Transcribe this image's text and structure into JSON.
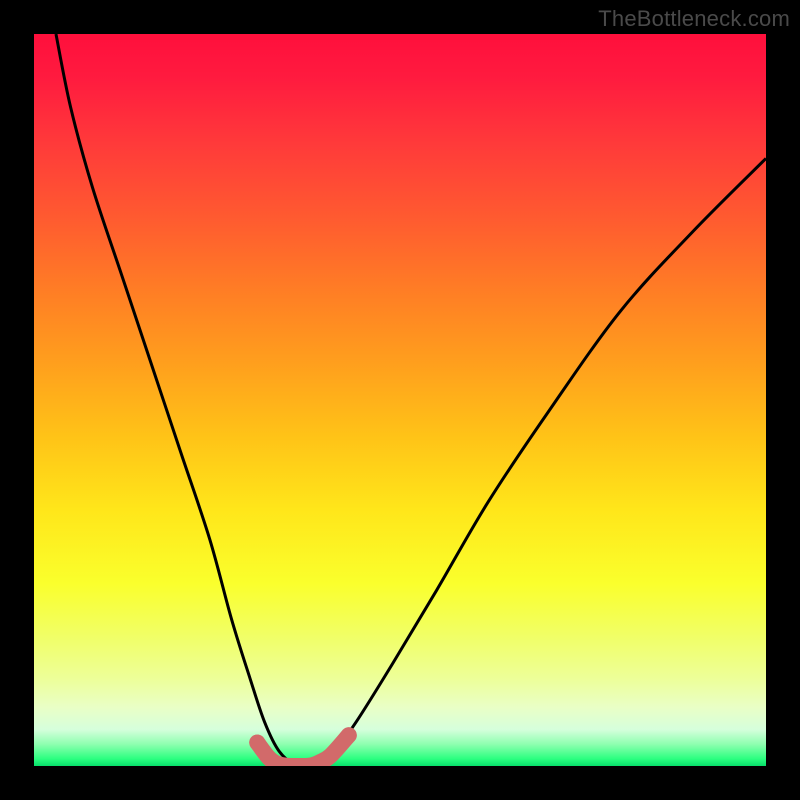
{
  "watermark": "TheBottleneck.com",
  "domain": "Chart",
  "chart_data": {
    "type": "line",
    "title": "",
    "xlabel": "",
    "ylabel": "",
    "xlim": [
      0,
      100
    ],
    "ylim": [
      0,
      100
    ],
    "background_gradient": {
      "direction": "vertical",
      "stops": [
        {
          "pct": 0,
          "meaning": "high-bottleneck",
          "color": "#ff0f3c"
        },
        {
          "pct": 50,
          "meaning": "moderate",
          "color": "#ffc317"
        },
        {
          "pct": 88,
          "meaning": "low",
          "color": "#edff98"
        },
        {
          "pct": 100,
          "meaning": "optimal",
          "color": "#08e06a"
        }
      ]
    },
    "series": [
      {
        "name": "bottleneck-curve",
        "color": "#000000",
        "x": [
          3,
          5,
          8,
          12,
          16,
          20,
          24,
          27,
          29.5,
          31.5,
          33.5,
          36,
          38.5,
          41,
          44,
          49,
          55,
          62,
          70,
          80,
          90,
          100
        ],
        "y": [
          100,
          90,
          79,
          67,
          55,
          43,
          31,
          20,
          12,
          6,
          2,
          0,
          0,
          2,
          6,
          14,
          24,
          36,
          48,
          62,
          73,
          83
        ]
      },
      {
        "name": "optimal-band-markers",
        "color": "#d26a6a",
        "marker": "round",
        "x": [
          30.5,
          32,
          33,
          34,
          35,
          36,
          37,
          38,
          39,
          40.5,
          43
        ],
        "y": [
          3.2,
          1.2,
          0.4,
          0.1,
          0,
          0,
          0,
          0.1,
          0.5,
          1.4,
          4.2
        ]
      }
    ],
    "annotations": []
  },
  "colors": {
    "curve": "#000000",
    "markers": "#d26a6a",
    "frame": "#000000",
    "watermark": "#4a4a4a"
  }
}
